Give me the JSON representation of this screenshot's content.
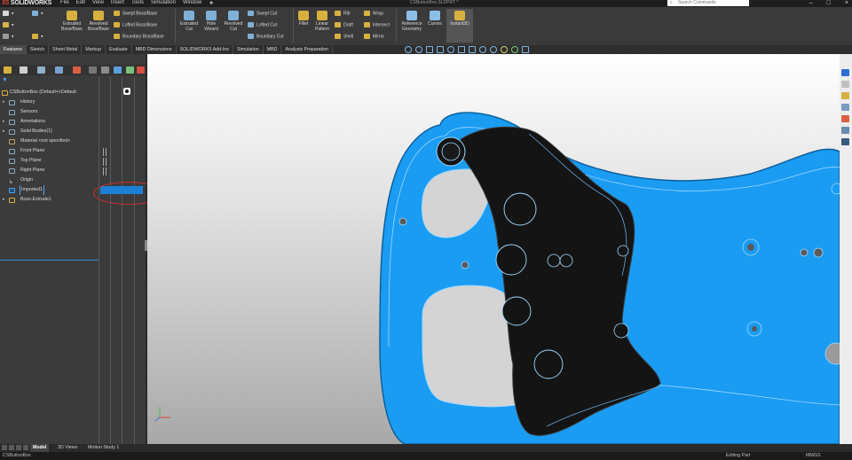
{
  "app": {
    "logo_prefix": "3S",
    "logo_name": "SOLIDWORKS",
    "doc_title": "CSButtonBox.SLDPRT *"
  },
  "menu": [
    "File",
    "Edit",
    "View",
    "Insert",
    "Tools",
    "Simulation",
    "Window"
  ],
  "search": {
    "placeholder": "Search Commands"
  },
  "ribbon": {
    "extruded_boss": "Extruded Boss/Base",
    "revolved_boss": "Revolved Boss/Base",
    "swept_boss": "Swept Boss/Base",
    "lofted_boss": "Lofted Boss/Base",
    "boundary_boss": "Boundary Boss/Base",
    "extruded_cut": "Extruded Cut",
    "hole_wizard": "Hole Wizard",
    "revolved_cut": "Revolved Cut",
    "swept_cut": "Swept Cut",
    "lofted_cut": "Lofted Cut",
    "boundary_cut": "Boundary Cut",
    "fillet": "Fillet",
    "linear_pattern": "Linear Pattern",
    "rib": "Rib",
    "draft": "Draft",
    "shell": "Shell",
    "wrap": "Wrap",
    "intersect": "Intersect",
    "mirror": "Mirror",
    "reference_geometry": "Reference Geometry",
    "curves": "Curves",
    "instant3d": "Instant3D"
  },
  "command_tabs": [
    "Features",
    "Sketch",
    "Sheet Metal",
    "Markup",
    "Evaluate",
    "MBD Dimensions",
    "SOLIDWORKS Add-Ins",
    "Simulation",
    "MBD",
    "Analysis Preparation"
  ],
  "tree": {
    "root": "CSButtonBox  (Default<<Default",
    "items": [
      "History",
      "Sensors",
      "Annotations",
      "Solid Bodies(1)",
      "Material <not specified>",
      "Front Plane",
      "Top Plane",
      "Right Plane",
      "Origin",
      "Imported1",
      "Boss-Extrude1"
    ]
  },
  "bottom_tabs": [
    "Model",
    "3D Views",
    "Motion Study 1"
  ],
  "status": {
    "doc": "CSButtonBox",
    "mode": "Editing Part",
    "units": "MMGS"
  },
  "colors": {
    "part_blue": "#1a9cf2",
    "grip_black": "#141414",
    "edge_line": "#a0d8ff",
    "selection_blue": "#1e7fd6",
    "annotation_red": "#d03030"
  }
}
